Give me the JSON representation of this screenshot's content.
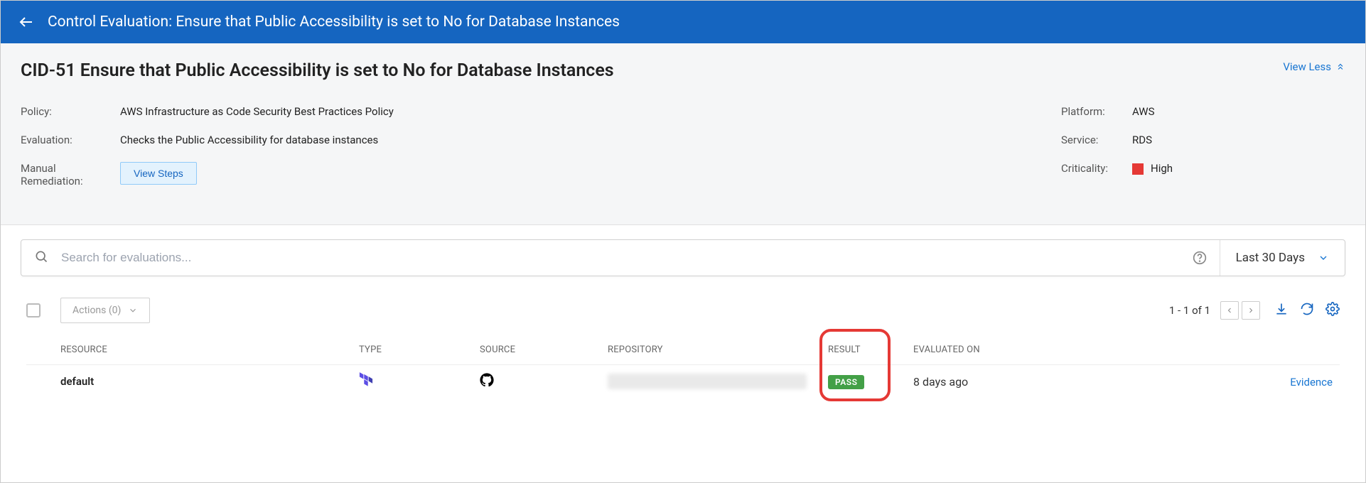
{
  "header": {
    "title": "Control Evaluation: Ensure that Public Accessibility is set to No for Database Instances"
  },
  "details": {
    "title": "CID-51 Ensure that Public Accessibility is set to No for Database Instances",
    "view_less": "View Less",
    "policy_label": "Policy:",
    "policy_value": "AWS Infrastructure as Code Security Best Practices Policy",
    "evaluation_label": "Evaluation:",
    "evaluation_value": "Checks the Public Accessibility for database instances",
    "manual_label": "Manual Remediation:",
    "view_steps": "View Steps",
    "platform_label": "Platform:",
    "platform_value": "AWS",
    "service_label": "Service:",
    "service_value": "RDS",
    "criticality_label": "Criticality:",
    "criticality_value": "High"
  },
  "search": {
    "placeholder": "Search for evaluations...",
    "date_filter": "Last 30 Days"
  },
  "toolbar": {
    "actions_label": "Actions (0)",
    "pager_text": "1 - 1 of  1"
  },
  "table": {
    "headers": {
      "resource": "RESOURCE",
      "type": "TYPE",
      "source": "SOURCE",
      "repository": "REPOSITORY",
      "result": "RESULT",
      "evaluated_on": "EVALUATED ON"
    },
    "rows": [
      {
        "resource": "default",
        "result": "PASS",
        "evaluated_on": "8 days ago",
        "evidence": "Evidence"
      }
    ]
  }
}
